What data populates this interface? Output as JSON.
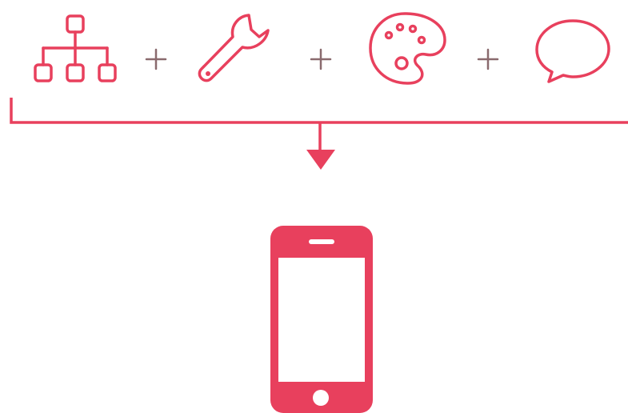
{
  "colors": {
    "accent": "#e8405d",
    "plus": "#8a6a6e",
    "background": "#ffffff",
    "screen": "#ffffff"
  },
  "icons": {
    "inputs": [
      "sitemap-icon",
      "wrench-icon",
      "palette-icon",
      "speech-bubble-icon"
    ],
    "operator": "plus-icon",
    "connector": "bracket-arrow",
    "output": "smartphone-icon"
  }
}
